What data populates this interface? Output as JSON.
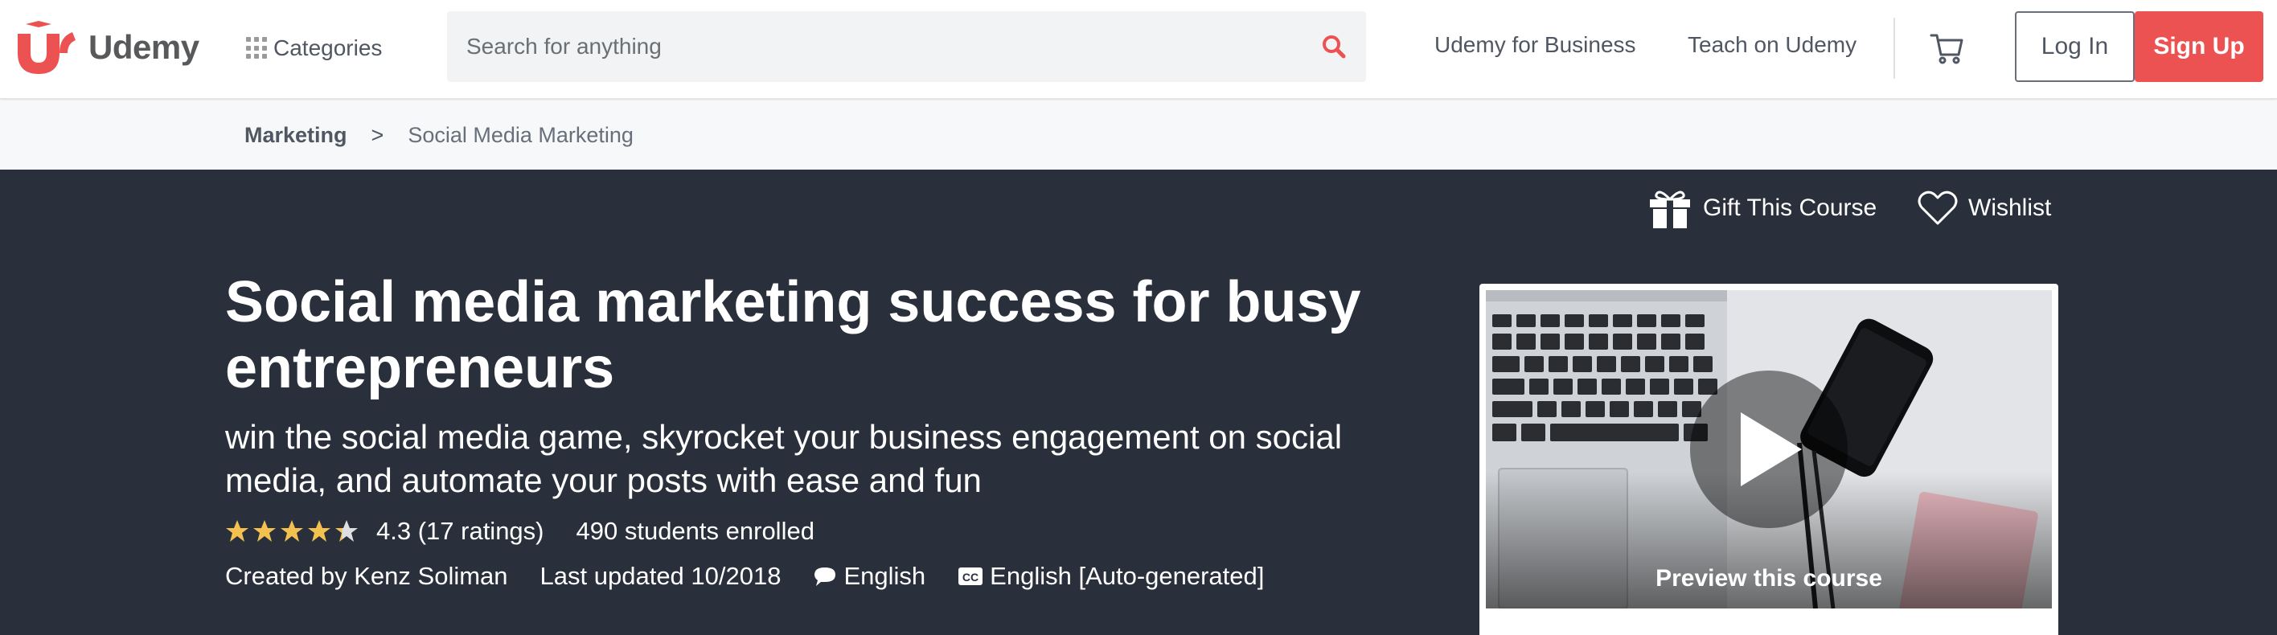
{
  "header": {
    "logo_text": "Udemy",
    "categories_label": "Categories",
    "search": {
      "placeholder": "Search for anything",
      "value": ""
    },
    "nav": {
      "business_label": "Udemy for Business",
      "teach_label": "Teach on Udemy"
    },
    "login_label": "Log In",
    "signup_label": "Sign Up"
  },
  "breadcrumb": {
    "items": [
      "Marketing",
      "Social Media Marketing"
    ],
    "separator": ">"
  },
  "hero": {
    "gift_label": "Gift This Course",
    "wishlist_label": "Wishlist",
    "title": "Social media marketing success for busy entrepreneurs",
    "subtitle": "win the social media game, skyrocket your business engagement on social media, and automate your posts with ease and fun",
    "rating": {
      "value": 4.3,
      "max": 5,
      "text": "4.3 (17 ratings)"
    },
    "students": "490 students enrolled",
    "created_by": "Created by Kenz Soliman",
    "last_updated": "Last updated 10/2018",
    "language": "English",
    "captions": "English [Auto-generated]",
    "preview_label": "Preview this course"
  },
  "colors": {
    "brand_red": "#ec5252",
    "hero_bg": "#29303b",
    "star": "#f4c150",
    "text_dark": "#505763"
  },
  "icons": {
    "search": "search-icon",
    "cart": "cart-icon",
    "gift": "gift-icon",
    "wishlist": "heart-icon",
    "language": "speech-bubble-icon",
    "captions": "closed-captions-icon",
    "play": "play-icon"
  }
}
